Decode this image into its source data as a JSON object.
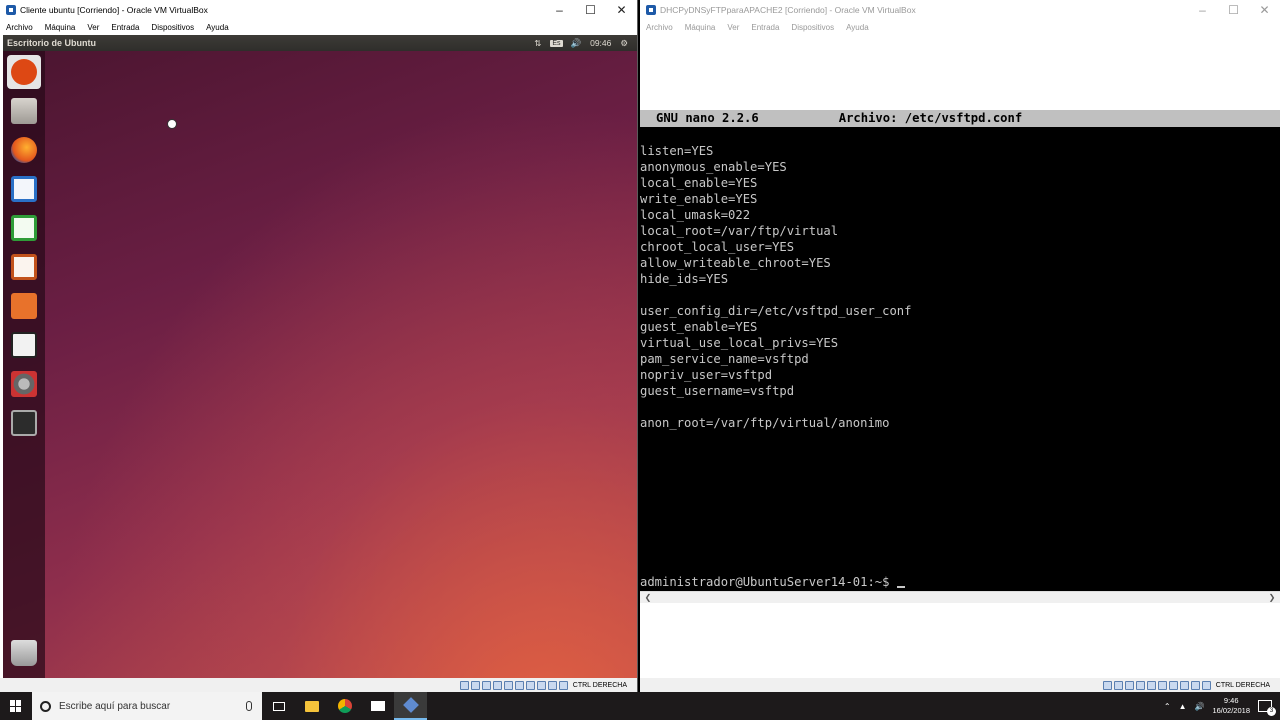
{
  "left_window": {
    "title": "Cliente ubuntu [Corriendo] - Oracle VM VirtualBox",
    "menu": [
      "Archivo",
      "Máquina",
      "Ver",
      "Entrada",
      "Dispositivos",
      "Ayuda"
    ],
    "ubuntu_topbar": {
      "title": "Escritorio de Ubuntu",
      "keyboard_layout": "Es",
      "time": "09:46"
    },
    "launcher_items": [
      "dash-home",
      "files",
      "firefox",
      "libreoffice-writer",
      "libreoffice-calc",
      "libreoffice-impress",
      "ubuntu-software-center",
      "amazon",
      "system-settings",
      "terminal",
      "trash"
    ],
    "hostkey": "CTRL DERECHA"
  },
  "right_window": {
    "title": "DHCPyDNSyFTPparaAPACHE2 [Corriendo] - Oracle VM VirtualBox",
    "menu": [
      "Archivo",
      "Máquina",
      "Ver",
      "Entrada",
      "Dispositivos",
      "Ayuda"
    ],
    "nano_version": "GNU nano 2.2.6",
    "nano_file": "Archivo: /etc/vsftpd.conf",
    "config_lines": [
      "listen=YES",
      "anonymous_enable=YES",
      "local_enable=YES",
      "write_enable=YES",
      "local_umask=022",
      "local_root=/var/ftp/virtual",
      "chroot_local_user=YES",
      "allow_writeable_chroot=YES",
      "hide_ids=YES",
      "",
      "user_config_dir=/etc/vsftpd_user_conf",
      "guest_enable=YES",
      "virtual_use_local_privs=YES",
      "pam_service_name=vsftpd",
      "nopriv_user=vsftpd",
      "guest_username=vsftpd",
      "",
      "anon_root=/var/ftp/virtual/anonimo"
    ],
    "prompt": "administrador@UbuntuServer14-01:~$ ",
    "hostkey": "CTRL DERECHA"
  },
  "taskbar": {
    "search_placeholder": "Escribe aquí para buscar",
    "time": "9:46",
    "date": "16/02/2018",
    "notification_count": "3"
  },
  "colors": {
    "ubuntu_panel": "#2f2e2b",
    "ubuntu_bg_dark": "#4b1530",
    "ubuntu_bg_warm": "#e96440",
    "nano_header_bg": "#c0c0c0",
    "console_text": "#c8c8c8"
  }
}
